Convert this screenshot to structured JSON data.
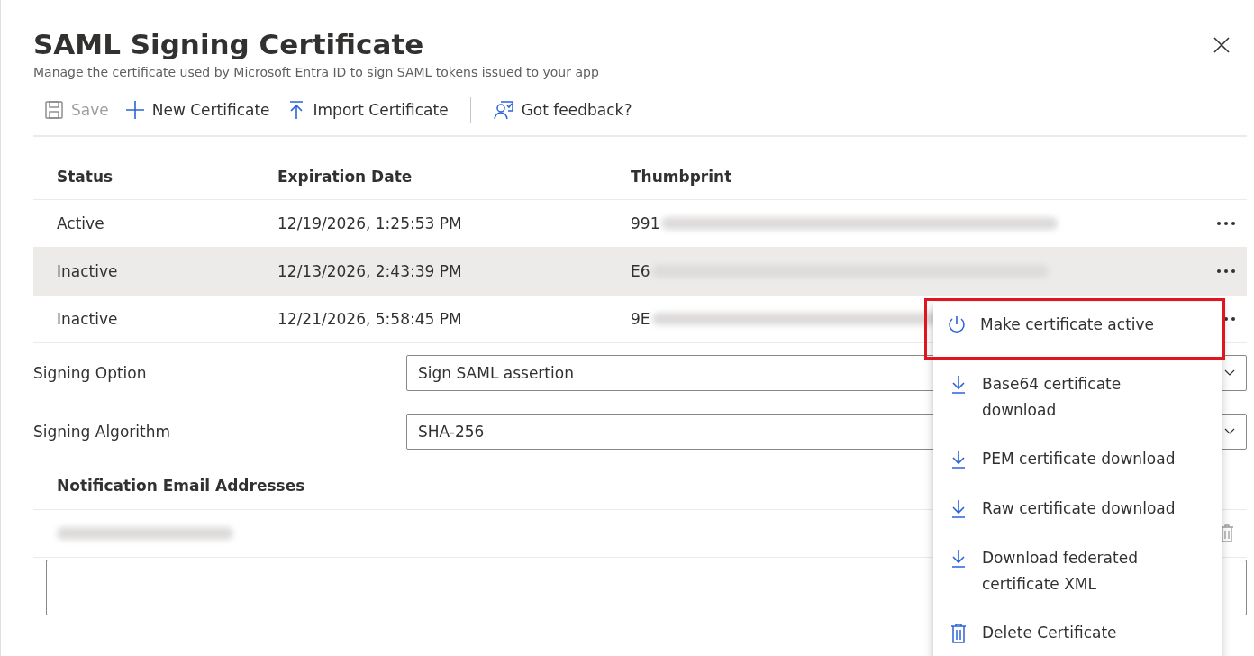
{
  "panel": {
    "title": "SAML Signing Certificate",
    "subtitle": "Manage the certificate used by Microsoft Entra ID to sign SAML tokens issued to your app"
  },
  "toolbar": [
    {
      "kind": "save",
      "label": "Save",
      "disabled": true
    },
    {
      "kind": "new",
      "label": "New Certificate",
      "disabled": false
    },
    {
      "kind": "import",
      "label": "Import Certificate",
      "disabled": false
    },
    {
      "kind": "feedback",
      "label": "Got feedback?",
      "disabled": false
    }
  ],
  "table": {
    "columns": [
      "Status",
      "Expiration Date",
      "Thumbprint"
    ],
    "rows": [
      {
        "status": "Active",
        "expiration": "12/19/2026, 1:25:53 PM",
        "thumbprint": "991",
        "selected": false
      },
      {
        "status": "Inactive",
        "expiration": "12/13/2026, 2:43:39 PM",
        "thumbprint": "E6",
        "selected": true
      },
      {
        "status": "Inactive",
        "expiration": "12/21/2026, 5:58:45 PM",
        "thumbprint": "9E",
        "selected": false
      }
    ]
  },
  "fields": [
    {
      "label": "Signing Option",
      "value": "Sign SAML assertion"
    },
    {
      "label": "Signing Algorithm",
      "value": "SHA-256"
    }
  ],
  "notification": {
    "heading": "Notification Email Addresses"
  },
  "context_menu": [
    {
      "kind": "power",
      "label": "Make certificate active",
      "highlighted": true
    },
    {
      "kind": "download",
      "label": "Base64 certificate download",
      "highlighted": false
    },
    {
      "kind": "download",
      "label": "PEM certificate download",
      "highlighted": false
    },
    {
      "kind": "download",
      "label": "Raw certificate download",
      "highlighted": false
    },
    {
      "kind": "download",
      "label": "Download federated certificate XML",
      "highlighted": false
    },
    {
      "kind": "delete",
      "label": "Delete Certificate",
      "highlighted": false
    }
  ]
}
